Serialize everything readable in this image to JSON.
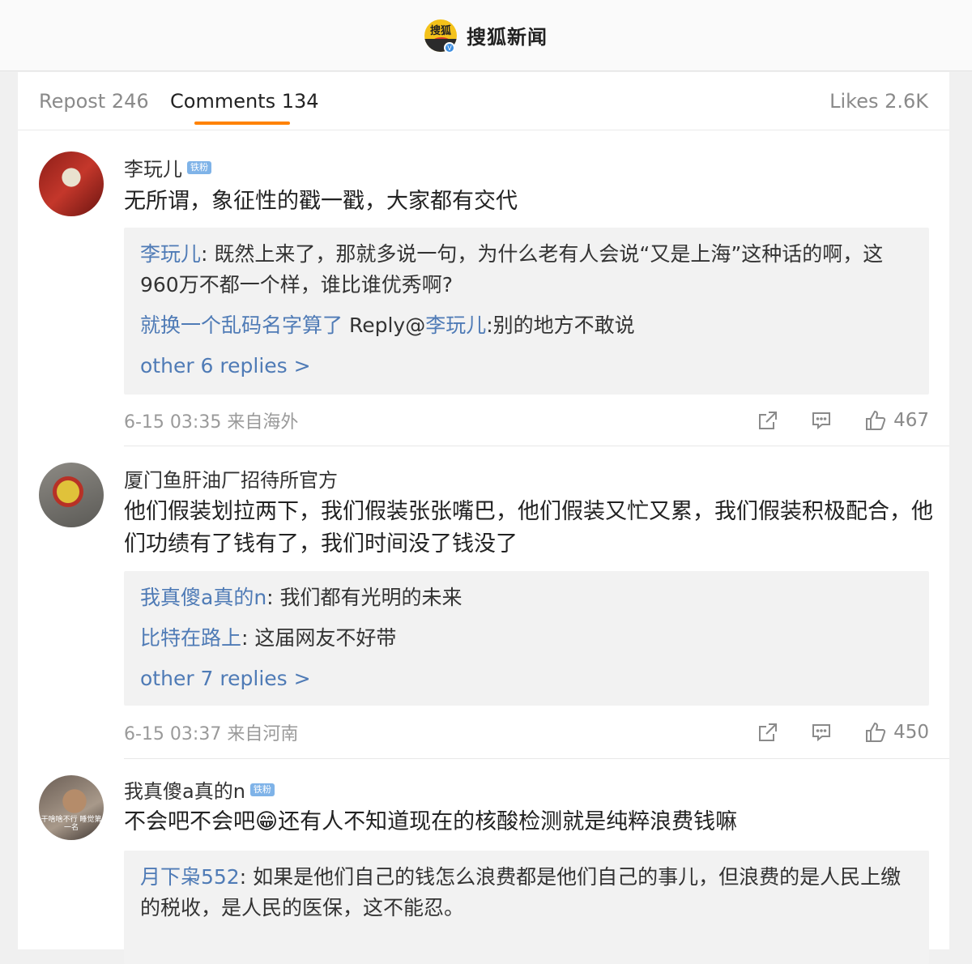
{
  "header": {
    "logo_text": "搜狐",
    "title": "搜狐新闻"
  },
  "tabs": {
    "repost": "Repost 246",
    "comments": "Comments 134",
    "likes": "Likes 2.6K"
  },
  "colors": {
    "accent": "#ff8200",
    "link": "#4f7bb6",
    "badge": "#7fb3e8"
  },
  "comments": [
    {
      "user": "李玩儿",
      "badge": "铁粉",
      "text": "无所谓，象征性的戳一戳，大家都有交代",
      "replies": [
        {
          "user": "李玩儿",
          "sep": ": ",
          "text": "既然上来了，那就多说一句，为什么老有人会说“又是上海”这种话的啊，这960万不都一个样，谁比谁优秀啊?"
        },
        {
          "user": "就换一个乱码名字算了",
          "mid": " Reply@",
          "at": "李玩儿",
          "sep": ":",
          "text": "别的地方不敢说"
        }
      ],
      "more": "other 6 replies >",
      "time": "6-15 03:35 来自海外",
      "likes": "467"
    },
    {
      "user": "厦门鱼肝油厂招待所官方",
      "text": "他们假装划拉两下，我们假装张张嘴巴，他们假装又忙又累，我们假装积极配合，他们功绩有了钱有了，我们时间没了钱没了",
      "replies": [
        {
          "user": "我真傻a真的n",
          "sep": ": ",
          "text": "我们都有光明的未来"
        },
        {
          "user": "比特在路上",
          "sep": ": ",
          "text": "这届网友不好带"
        }
      ],
      "more": "other 7 replies >",
      "time": "6-15 03:37 来自河南",
      "likes": "450"
    },
    {
      "user": "我真傻a真的n",
      "badge": "铁粉",
      "avatar_caption": "干啥啥不行 睡觉第一名",
      "text_pre": "不会吧不会吧",
      "emoji": "😁",
      "text_post": "还有人不知道现在的核酸检测就是纯粹浪费钱嘛",
      "replies": [
        {
          "user": "月下枭552",
          "sep": ": ",
          "text": "如果是他们自己的钱怎么浪费都是他们自己的事儿，但浪费的是人民上缴的税收，是人民的医保，这不能忍。"
        }
      ]
    }
  ]
}
